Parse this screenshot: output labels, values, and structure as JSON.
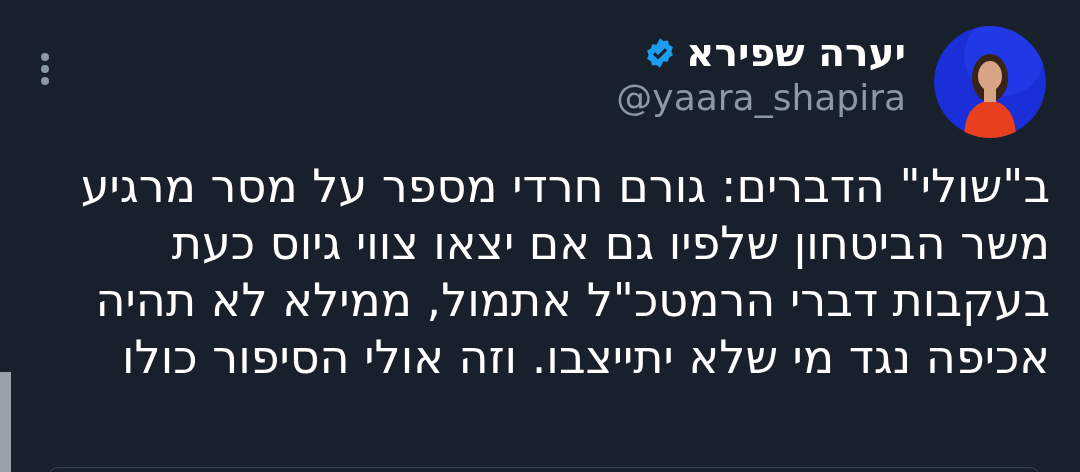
{
  "author": {
    "name": "יערה שפירא",
    "verified": true,
    "handle": "@yaara_shapira"
  },
  "body_lines": [
    "ב\"שולי\" הדברים: גורם חרדי מספר על מסר מרגיע",
    "משר הביטחון שלפיו גם אם יצאו צווי גיוס כעת",
    "בעקבות דברי הרמטכ\"ל אתמול, ממילא לא תהיה",
    "אכיפה נגד מי שלא יתייצבו. וזה אולי הסיפור כולו"
  ]
}
